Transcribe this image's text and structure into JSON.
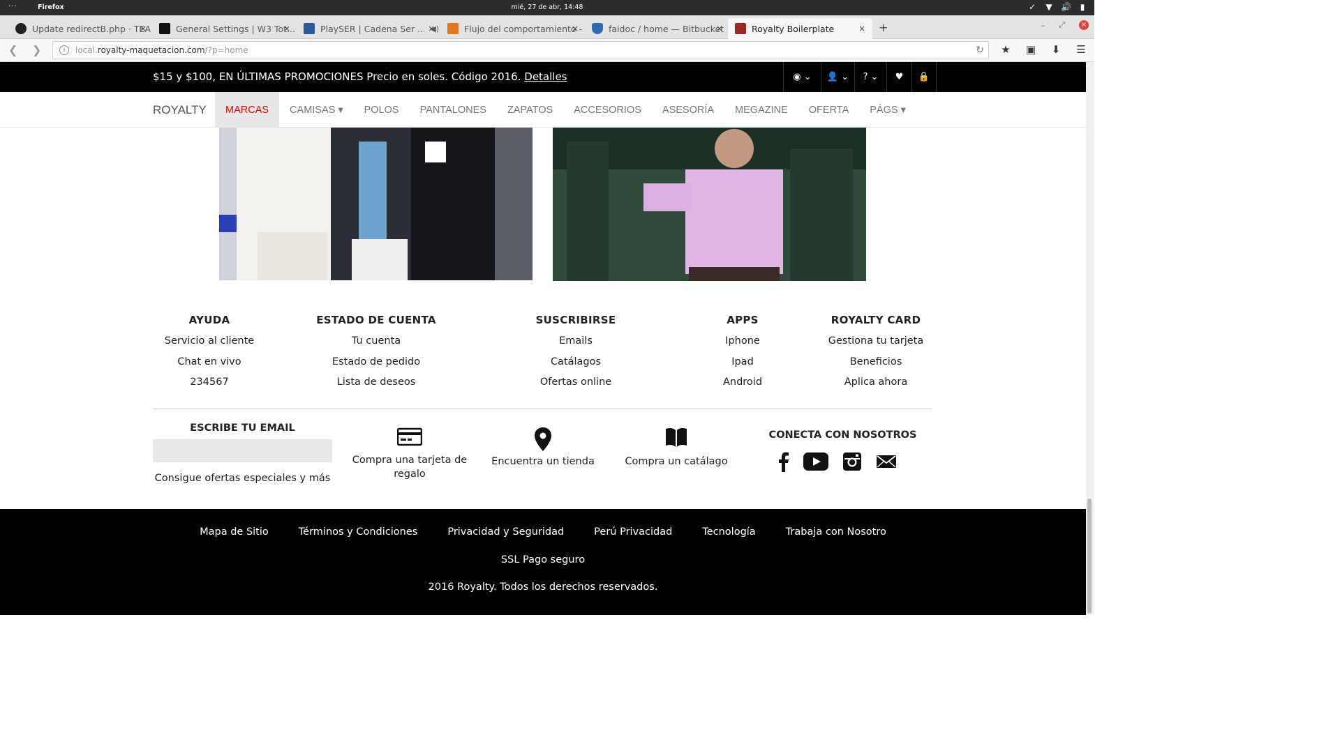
{
  "os": {
    "app_name": "Firefox",
    "clock": "mié, 27 de abr, 14:48"
  },
  "tabs": [
    {
      "title": "Update redirectB.php · TEA...",
      "color": "#222222"
    },
    {
      "title": "General Settings | W3 Tot...",
      "color": "#111111"
    },
    {
      "title": "PlaySER | Cadena Ser ...",
      "color": "#2a5a9a"
    },
    {
      "title": "Flujo del comportamiento -...",
      "color": "#e8741e"
    },
    {
      "title": "faidoc / home — Bitbucket",
      "color": "#2d6cb5"
    },
    {
      "title": "Royalty Boilerplate",
      "color": "#a0281e"
    }
  ],
  "url": {
    "prefix": "local.",
    "host": "royalty-maquetacion.com",
    "path": "/?p=home"
  },
  "promo": {
    "text": "$15 y $100, EN ÚLTIMAS PROMOCIONES Precio en soles. Código 2016.",
    "link": "Detalles"
  },
  "nav": {
    "brand": "ROYALTY",
    "items": [
      "MARCAS",
      "CAMISAS ▾",
      "POLOS",
      "PANTALONES",
      "ZAPATOS",
      "ACCESORIOS",
      "ASESORÍA",
      "MEGAZINE",
      "OFERTA",
      "PÁGS ▾"
    ]
  },
  "footer": {
    "columns": [
      {
        "title": "AYUDA",
        "links": [
          "Servicio al cliente",
          "Chat en vivo",
          "234567"
        ]
      },
      {
        "title": "ESTADO DE CUENTA",
        "links": [
          "Tu cuenta",
          "Estado de pedido",
          "Lista de deseos"
        ]
      },
      {
        "title": "SUSCRIBIRSE",
        "links": [
          "Emails",
          "Catálagos",
          "Ofertas online"
        ]
      },
      {
        "title": "APPS",
        "links": [
          "Iphone",
          "Ipad",
          "Android"
        ]
      },
      {
        "title": "ROYALTY CARD",
        "links": [
          "Gestiona tu tarjeta",
          "Beneficios",
          "Aplica ahora"
        ]
      }
    ],
    "subscribe": {
      "title": "ESCRIBE TU EMAIL",
      "placeholder": "",
      "note": "Consigue ofertas especiales y más"
    },
    "features": [
      "Compra una tarjeta de regalo",
      "Encuentra un tienda",
      "Compra un catálago"
    ],
    "social_title": "CONECTA CON NOSOTROS",
    "bottom_links": [
      "Mapa de Sitio",
      "Términos y Condiciones",
      "Privacidad y Seguridad",
      "Perú Privacidad",
      "Tecnología",
      "Trabaja con Nosotro"
    ],
    "ssl": "SSL Pago seguro",
    "copyright": "2016 Royalty. Todos los derechos reservados."
  }
}
